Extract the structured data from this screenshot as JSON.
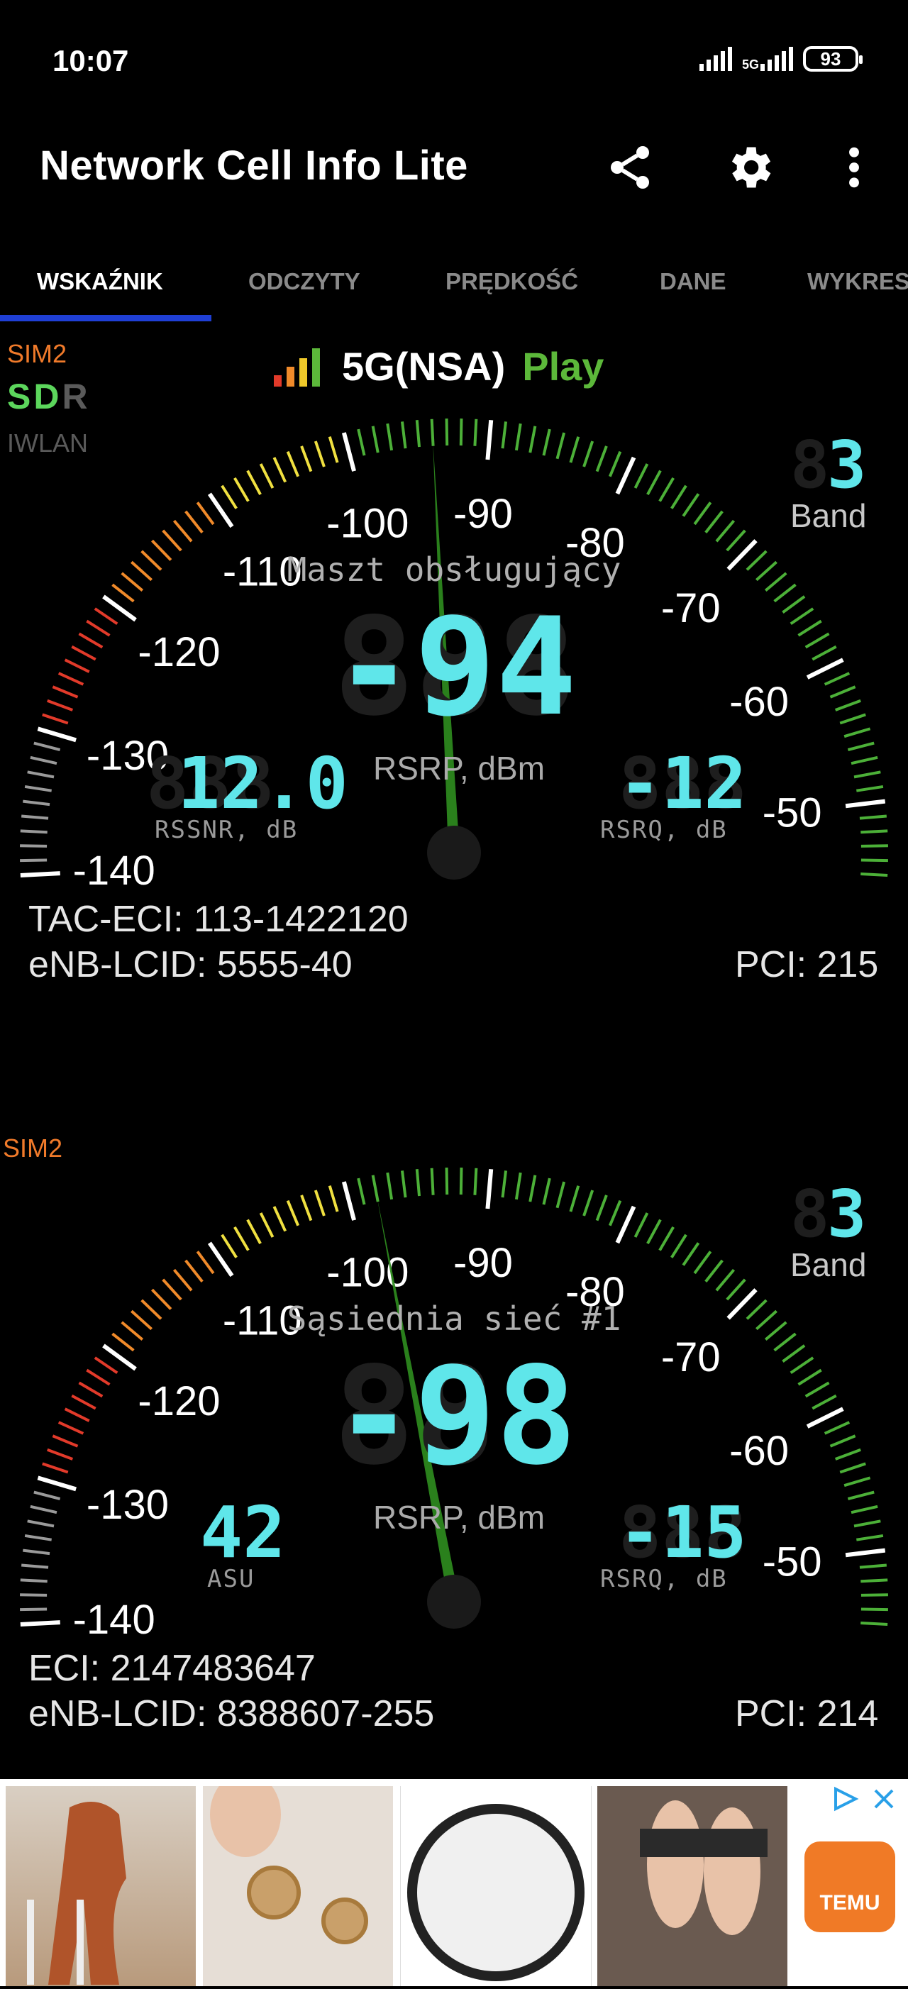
{
  "status_bar": {
    "time": "10:07",
    "network": "5G",
    "battery": "93"
  },
  "app_bar": {
    "title": "Network Cell Info Lite",
    "icons": [
      "share-icon",
      "gear-icon",
      "more-vert-icon"
    ]
  },
  "tabs": [
    "WSKAŹNIK",
    "ODCZYTY",
    "PRĘDKOŚĆ",
    "DANE",
    "WYKRES"
  ],
  "colors": {
    "accent": "#1f3fd4",
    "sim": "#f07a2a",
    "carrier": "#5cb83a",
    "digits": "#5fe6ea",
    "needle": "#2e8b1e"
  },
  "cell1": {
    "sim": "SIM2",
    "sdr": {
      "s": "S",
      "d": "D",
      "r": "R"
    },
    "iwlan": "IWLAN",
    "network_type": "5G(NSA)",
    "operator": "Play",
    "title": "Maszt obsługujący",
    "band": "3",
    "band_label": "Band",
    "main_value": "-94",
    "main_unit": "RSRP, dBm",
    "left_value": "12.0",
    "left_label": "RSSNR, dB",
    "right_value": "-12",
    "right_label": "RSRQ, dB",
    "line1": "TAC-ECI: 113-1422120",
    "line2": "eNB-LCID: 5555-40",
    "pci": "PCI: 215",
    "needle_dbm": -94
  },
  "cell2": {
    "sim": "SIM2",
    "title": "Sąsiednia sieć #1",
    "band": "3",
    "band_label": "Band",
    "main_value": "-98",
    "main_unit": "RSRP, dBm",
    "left_value": "42",
    "left_label": "ASU",
    "right_value": "-15",
    "right_label": "RSRQ, dB",
    "line1": "ECI: 2147483647",
    "line2": "eNB-LCID: 8388607-255",
    "pci": "PCI: 214",
    "needle_dbm": -98
  },
  "gauge_scale": [
    "-140",
    "-130",
    "-120",
    "-110",
    "-100",
    "-90",
    "-80",
    "-70",
    "-60",
    "-50"
  ],
  "ad": {
    "brand": "TEMU"
  }
}
